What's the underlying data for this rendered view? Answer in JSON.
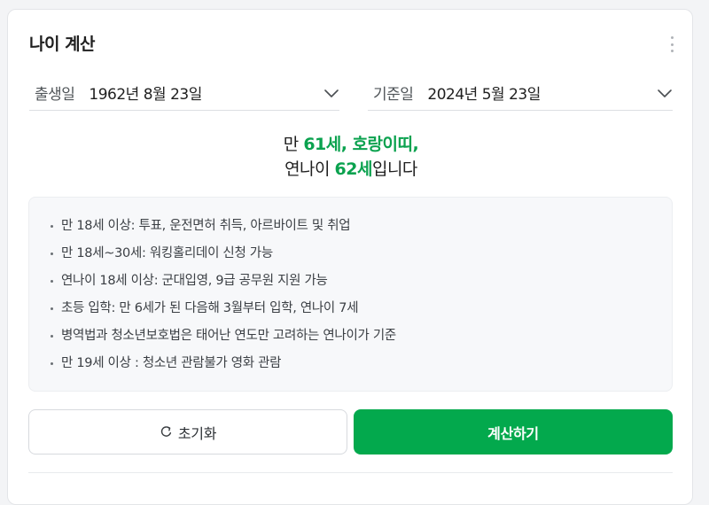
{
  "widget": {
    "title": "나이 계산"
  },
  "birth": {
    "label": "출생일",
    "value": "1962년 8월 23일"
  },
  "reference": {
    "label": "기준일",
    "value": "2024년 5월 23일"
  },
  "result": {
    "line1_prefix": "만 ",
    "age": "61세",
    "sep": ", ",
    "zodiac": "호랑이띠",
    "line1_suffix": ",",
    "line2_prefix": "연나이 ",
    "korean_age": "62세",
    "line2_suffix": "입니다"
  },
  "info": {
    "items": [
      "만 18세 이상: 투표, 운전면허 취득, 아르바이트 및 취업",
      "만 18세~30세: 워킹홀리데이 신청 가능",
      "연나이 18세 이상: 군대입영, 9급 공무원 지원 가능",
      "초등 입학: 만 6세가 된 다음해 3월부터 입학, 연나이 7세",
      "병역법과 청소년보호법은 태어난 연도만 고려하는 연나이가 기준",
      "만 19세 이상 : 청소년 관람불가 영화 관람"
    ]
  },
  "buttons": {
    "reset_label": "초기화",
    "calc_label": "계산하기"
  },
  "icons": {
    "more": "more-vertical-icon",
    "chevron": "chevron-down-icon",
    "reset": "refresh-icon"
  },
  "colors": {
    "accent": "#03a94d",
    "highlight_text": "#0ba24f"
  }
}
